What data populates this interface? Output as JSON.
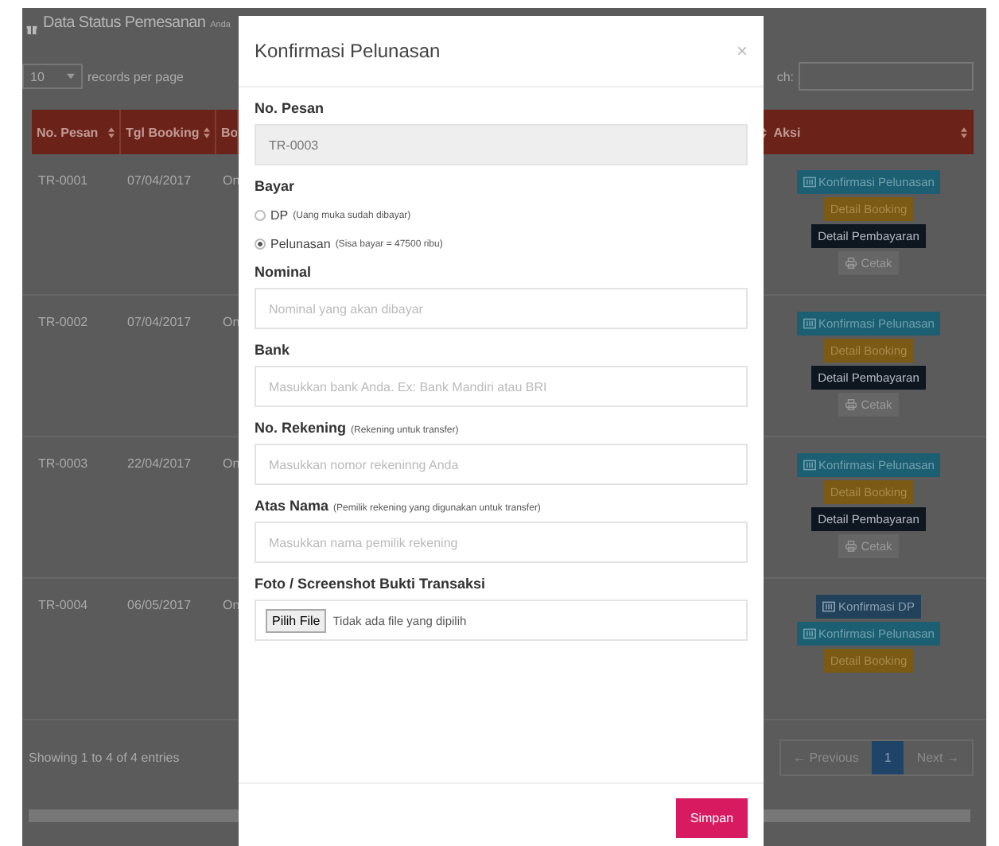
{
  "page": {
    "title": "Data Status Pemesanan",
    "subtitle": "Anda",
    "length_value": "10",
    "length_label": "records per page",
    "search_label": "ch:"
  },
  "table": {
    "columns": [
      {
        "label": "No. Pesan"
      },
      {
        "label": "Tgl Booking"
      },
      {
        "label": "Bo"
      },
      {
        "label": "Aksi"
      }
    ],
    "rows": [
      {
        "no": "TR-0001",
        "date": "07/04/2017",
        "column_3": "On",
        "actions": [
          {
            "kind": "confirm",
            "label": "Konfirmasi Pelunasan"
          },
          {
            "kind": "detail",
            "label": "Detail Booking"
          },
          {
            "kind": "payment",
            "label": "Detail Pembayaran"
          },
          {
            "kind": "print",
            "label": "Cetak"
          }
        ]
      },
      {
        "no": "TR-0002",
        "date": "07/04/2017",
        "column_3": "On",
        "actions": [
          {
            "kind": "confirm",
            "label": "Konfirmasi Pelunasan"
          },
          {
            "kind": "detail",
            "label": "Detail Booking"
          },
          {
            "kind": "payment",
            "label": "Detail Pembayaran"
          },
          {
            "kind": "print",
            "label": "Cetak"
          }
        ]
      },
      {
        "no": "TR-0003",
        "date": "22/04/2017",
        "column_3": "On",
        "actions": [
          {
            "kind": "confirm",
            "label": "Konfirmasi Pelunasan"
          },
          {
            "kind": "detail",
            "label": "Detail Booking"
          },
          {
            "kind": "payment",
            "label": "Detail Pembayaran"
          },
          {
            "kind": "print",
            "label": "Cetak"
          }
        ]
      },
      {
        "no": "TR-0004",
        "date": "06/05/2017",
        "column_3": "On",
        "actions": [
          {
            "kind": "confirm_dp",
            "label": "Konfirmasi DP"
          },
          {
            "kind": "confirm",
            "label": "Konfirmasi Pelunasan"
          },
          {
            "kind": "detail",
            "label": "Detail Booking"
          }
        ]
      }
    ]
  },
  "info": "Showing 1 to 4 of 4 entries",
  "pagination": [
    {
      "label": "← Previous",
      "selected": false
    },
    {
      "label": "1",
      "selected": true
    },
    {
      "label": "Next →",
      "selected": false
    }
  ],
  "modal": {
    "title": "Konfirmasi Pelunasan",
    "close": "×",
    "fields": [
      {
        "kind": "readonly",
        "label": "No. Pesan",
        "value": "TR-0003"
      },
      {
        "kind": "radio",
        "label": "Bayar",
        "options": [
          {
            "label": "DP",
            "note": "(Uang muka sudah dibayar)",
            "selected": false
          },
          {
            "label": "Pelunasan",
            "note": "(Sisa bayar = 47500 ribu)",
            "selected": true
          }
        ]
      },
      {
        "kind": "text",
        "label": "Nominal",
        "placeholder": "Nominal yang akan dibayar"
      },
      {
        "kind": "text",
        "label": "Bank",
        "placeholder": "Masukkan bank Anda. Ex: Bank Mandiri atau BRI"
      },
      {
        "kind": "text",
        "label": "No. Rekening",
        "note": "(Rekening untuk transfer)",
        "placeholder": "Masukkan nomor rekeninng Anda"
      },
      {
        "kind": "text",
        "label": "Atas Nama",
        "note": "(Pemilik rekening yang digunakan untuk transfer)",
        "placeholder": "Masukkan nama pemilik rekening"
      },
      {
        "kind": "file",
        "label": "Foto / Screenshot Bukti Transaksi",
        "button": "Pilih File",
        "status": "Tidak ada file yang dipilih"
      }
    ],
    "submit": "Simpan"
  }
}
